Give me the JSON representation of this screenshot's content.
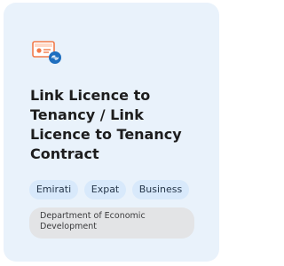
{
  "card": {
    "icon": "licence-card-link-icon",
    "title": "Link Licence to Tenancy / Link Licence to Tenancy Contract",
    "tags": [
      "Emirati",
      "Expat",
      "Business"
    ],
    "department": "Department of Economic Development"
  },
  "colors": {
    "card_background": "#e9f2fb",
    "tag_background": "#d8e9fb",
    "department_background": "#e3e4e6",
    "icon_orange": "#f27a4a",
    "icon_blue": "#1f6fbf"
  }
}
